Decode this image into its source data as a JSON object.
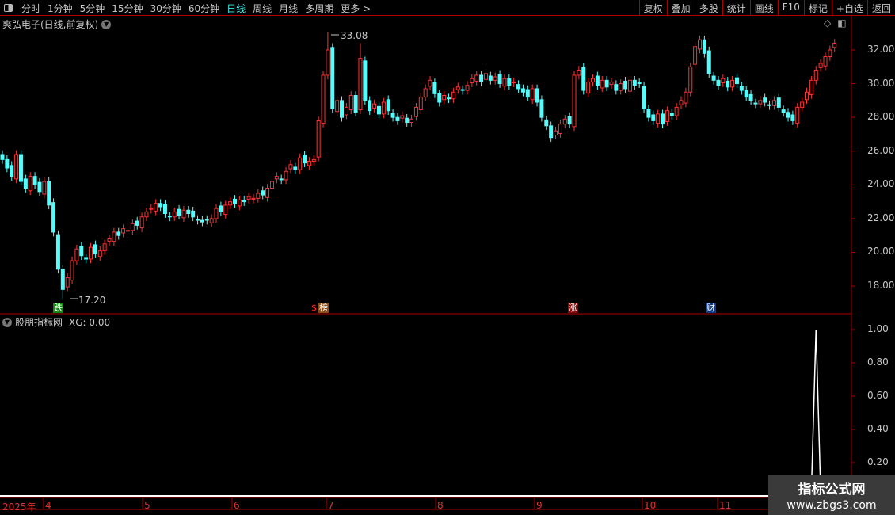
{
  "toolbar": {
    "periods": [
      "分时",
      "1分钟",
      "5分钟",
      "15分钟",
      "30分钟",
      "60分钟",
      "日线",
      "周线",
      "月线",
      "多周期",
      "更多 >"
    ],
    "active_period": "日线",
    "buttons": [
      "复权",
      "叠加",
      "多股",
      "统计",
      "画线",
      "F10",
      "标记",
      "+自选",
      "返回"
    ]
  },
  "main": {
    "title": "爽弘电子(日线,前复权)",
    "high_label": "33.08",
    "low_label": "17.20",
    "axis_ticks": [
      "32.00",
      "30.00",
      "28.00",
      "26.00",
      "24.00",
      "22.00",
      "20.00",
      "18.00"
    ]
  },
  "events": [
    {
      "text": "跌",
      "color": "#0a8a0a"
    },
    {
      "text": "$",
      "color": "#ff3030"
    },
    {
      "text": "榜",
      "color": "#8a4a10"
    },
    {
      "text": "涨",
      "color": "#8a0a0a"
    },
    {
      "text": "财",
      "color": "#0a3a8a"
    }
  ],
  "sub": {
    "title": "股朋指标网",
    "indicator": "XG: 0.00",
    "axis_ticks": [
      "1.00",
      "0.80",
      "0.60",
      "0.40",
      "0.20"
    ]
  },
  "date_axis": [
    "2025年",
    "4",
    "5",
    "6",
    "7",
    "8",
    "9",
    "10",
    "11"
  ],
  "watermark": {
    "name": "指标公式网",
    "url": "www.zbgs3.com"
  },
  "colors": {
    "up": "#ff3232",
    "down": "#54fcfc",
    "grid": "#b00000",
    "xg_line": "#ffffff"
  },
  "chart_data": {
    "type": "candlestick",
    "price_range": [
      16.5,
      33.5
    ],
    "high": 33.08,
    "low": 17.2,
    "closes": [
      25.5,
      25.0,
      24.5,
      25.8,
      24.2,
      23.8,
      24.5,
      24.0,
      23.6,
      24.2,
      22.8,
      21.2,
      19.0,
      17.8,
      18.5,
      19.5,
      20.2,
      19.8,
      19.6,
      20.3,
      19.9,
      20.1,
      20.5,
      20.8,
      21.2,
      21.0,
      21.4,
      21.3,
      21.7,
      21.6,
      22.1,
      22.4,
      22.6,
      22.9,
      22.7,
      22.3,
      22.1,
      22.4,
      22.2,
      22.5,
      22.3,
      22.1,
      21.9,
      21.8,
      21.9,
      22.0,
      22.6,
      22.4,
      22.8,
      23.0,
      22.9,
      23.1,
      23.0,
      23.3,
      23.2,
      23.5,
      23.4,
      23.8,
      24.2,
      24.5,
      24.3,
      24.8,
      25.2,
      24.9,
      25.6,
      25.3,
      25.4,
      25.5,
      27.8,
      30.5,
      32.0,
      28.5,
      29.0,
      28.0,
      28.6,
      29.3,
      28.3,
      31.5,
      29.0,
      28.4,
      28.8,
      28.2,
      28.9,
      28.4,
      28.0,
      27.8,
      28.1,
      27.7,
      27.9,
      28.6,
      29.2,
      29.7,
      30.2,
      29.4,
      28.9,
      29.3,
      29.1,
      29.5,
      29.8,
      29.6,
      29.9,
      30.3,
      30.5,
      30.1,
      30.6,
      30.2,
      30.4,
      30.0,
      30.3,
      29.9,
      30.1,
      29.7,
      29.5,
      29.2,
      29.7,
      28.9,
      28.0,
      27.5,
      26.8,
      27.2,
      27.6,
      27.9,
      27.6,
      30.5,
      30.8,
      29.6,
      30.1,
      30.3,
      29.9,
      30.2,
      29.8,
      30.1,
      29.6,
      30.0,
      29.7,
      30.2,
      29.9,
      30.0,
      28.5,
      28.0,
      27.8,
      28.2,
      27.6,
      28.4,
      28.1,
      28.6,
      29.0,
      29.5,
      31.0,
      32.2,
      32.6,
      31.8,
      30.6,
      30.2,
      29.9,
      30.3,
      29.8,
      30.2,
      30.0,
      29.6,
      29.2,
      29.0,
      28.8,
      29.0,
      28.9,
      28.7,
      29.0,
      28.6,
      28.3,
      28.0,
      27.8,
      28.6,
      28.9,
      29.5,
      30.2,
      30.8,
      31.2,
      31.6,
      32.0,
      32.4
    ],
    "xg_signal_index": 175,
    "xg_range": [
      0,
      1
    ]
  }
}
